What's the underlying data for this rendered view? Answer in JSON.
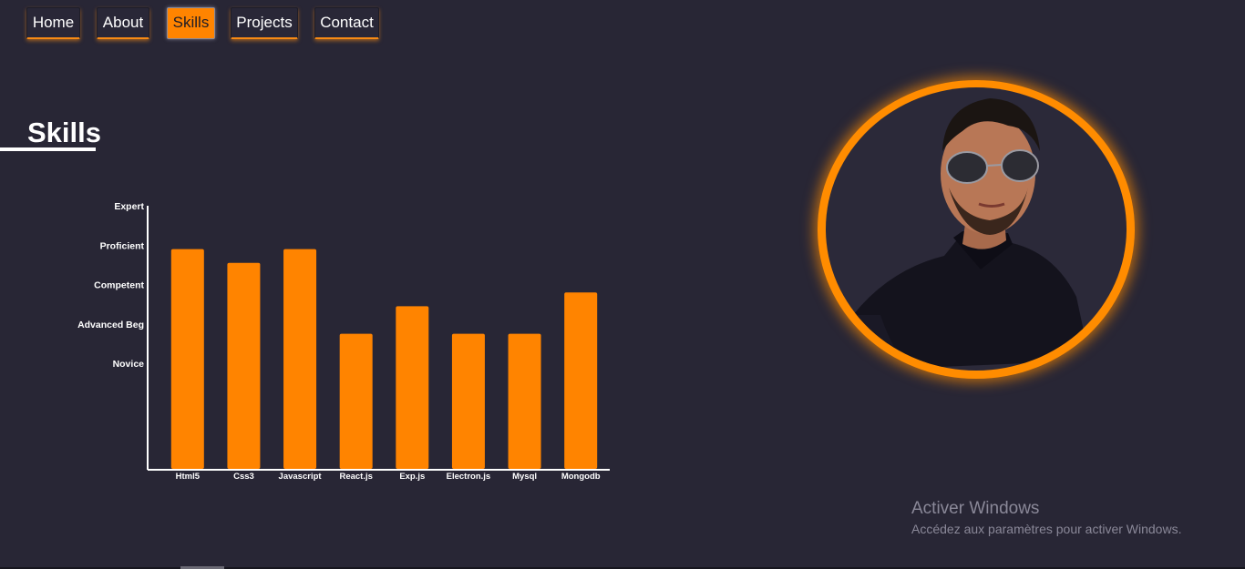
{
  "nav": {
    "items": [
      {
        "label": "Home"
      },
      {
        "label": "About"
      },
      {
        "label": "Skills"
      },
      {
        "label": "Projects"
      },
      {
        "label": "Contact"
      }
    ],
    "active_index": 2
  },
  "section": {
    "title": "Skills"
  },
  "chart_data": {
    "type": "bar",
    "categories": [
      "Html5",
      "Css3",
      "Javascript",
      "React.js",
      "Exp.js",
      "Electron.js",
      "Mysql",
      "Mongodb"
    ],
    "y_levels": [
      "Novice",
      "Advanced Beg",
      "Competent",
      "Proficient",
      "Expert"
    ],
    "y_level_values": [
      1,
      2,
      3,
      4,
      5
    ],
    "values": [
      3.9,
      3.55,
      3.9,
      1.75,
      2.45,
      1.75,
      1.75,
      2.8
    ],
    "ylim": [
      -1.7,
      5
    ],
    "bar_color": "#ff8400",
    "title": "",
    "xlabel": "",
    "ylabel": ""
  },
  "profile": {
    "photo_alt": "profile photo"
  },
  "watermark": {
    "title": "Activer Windows",
    "subtitle": "Accédez aux paramètres pour activer Windows."
  },
  "colors": {
    "background": "#282635",
    "accent": "#ff8400",
    "text": "#ffffff"
  }
}
